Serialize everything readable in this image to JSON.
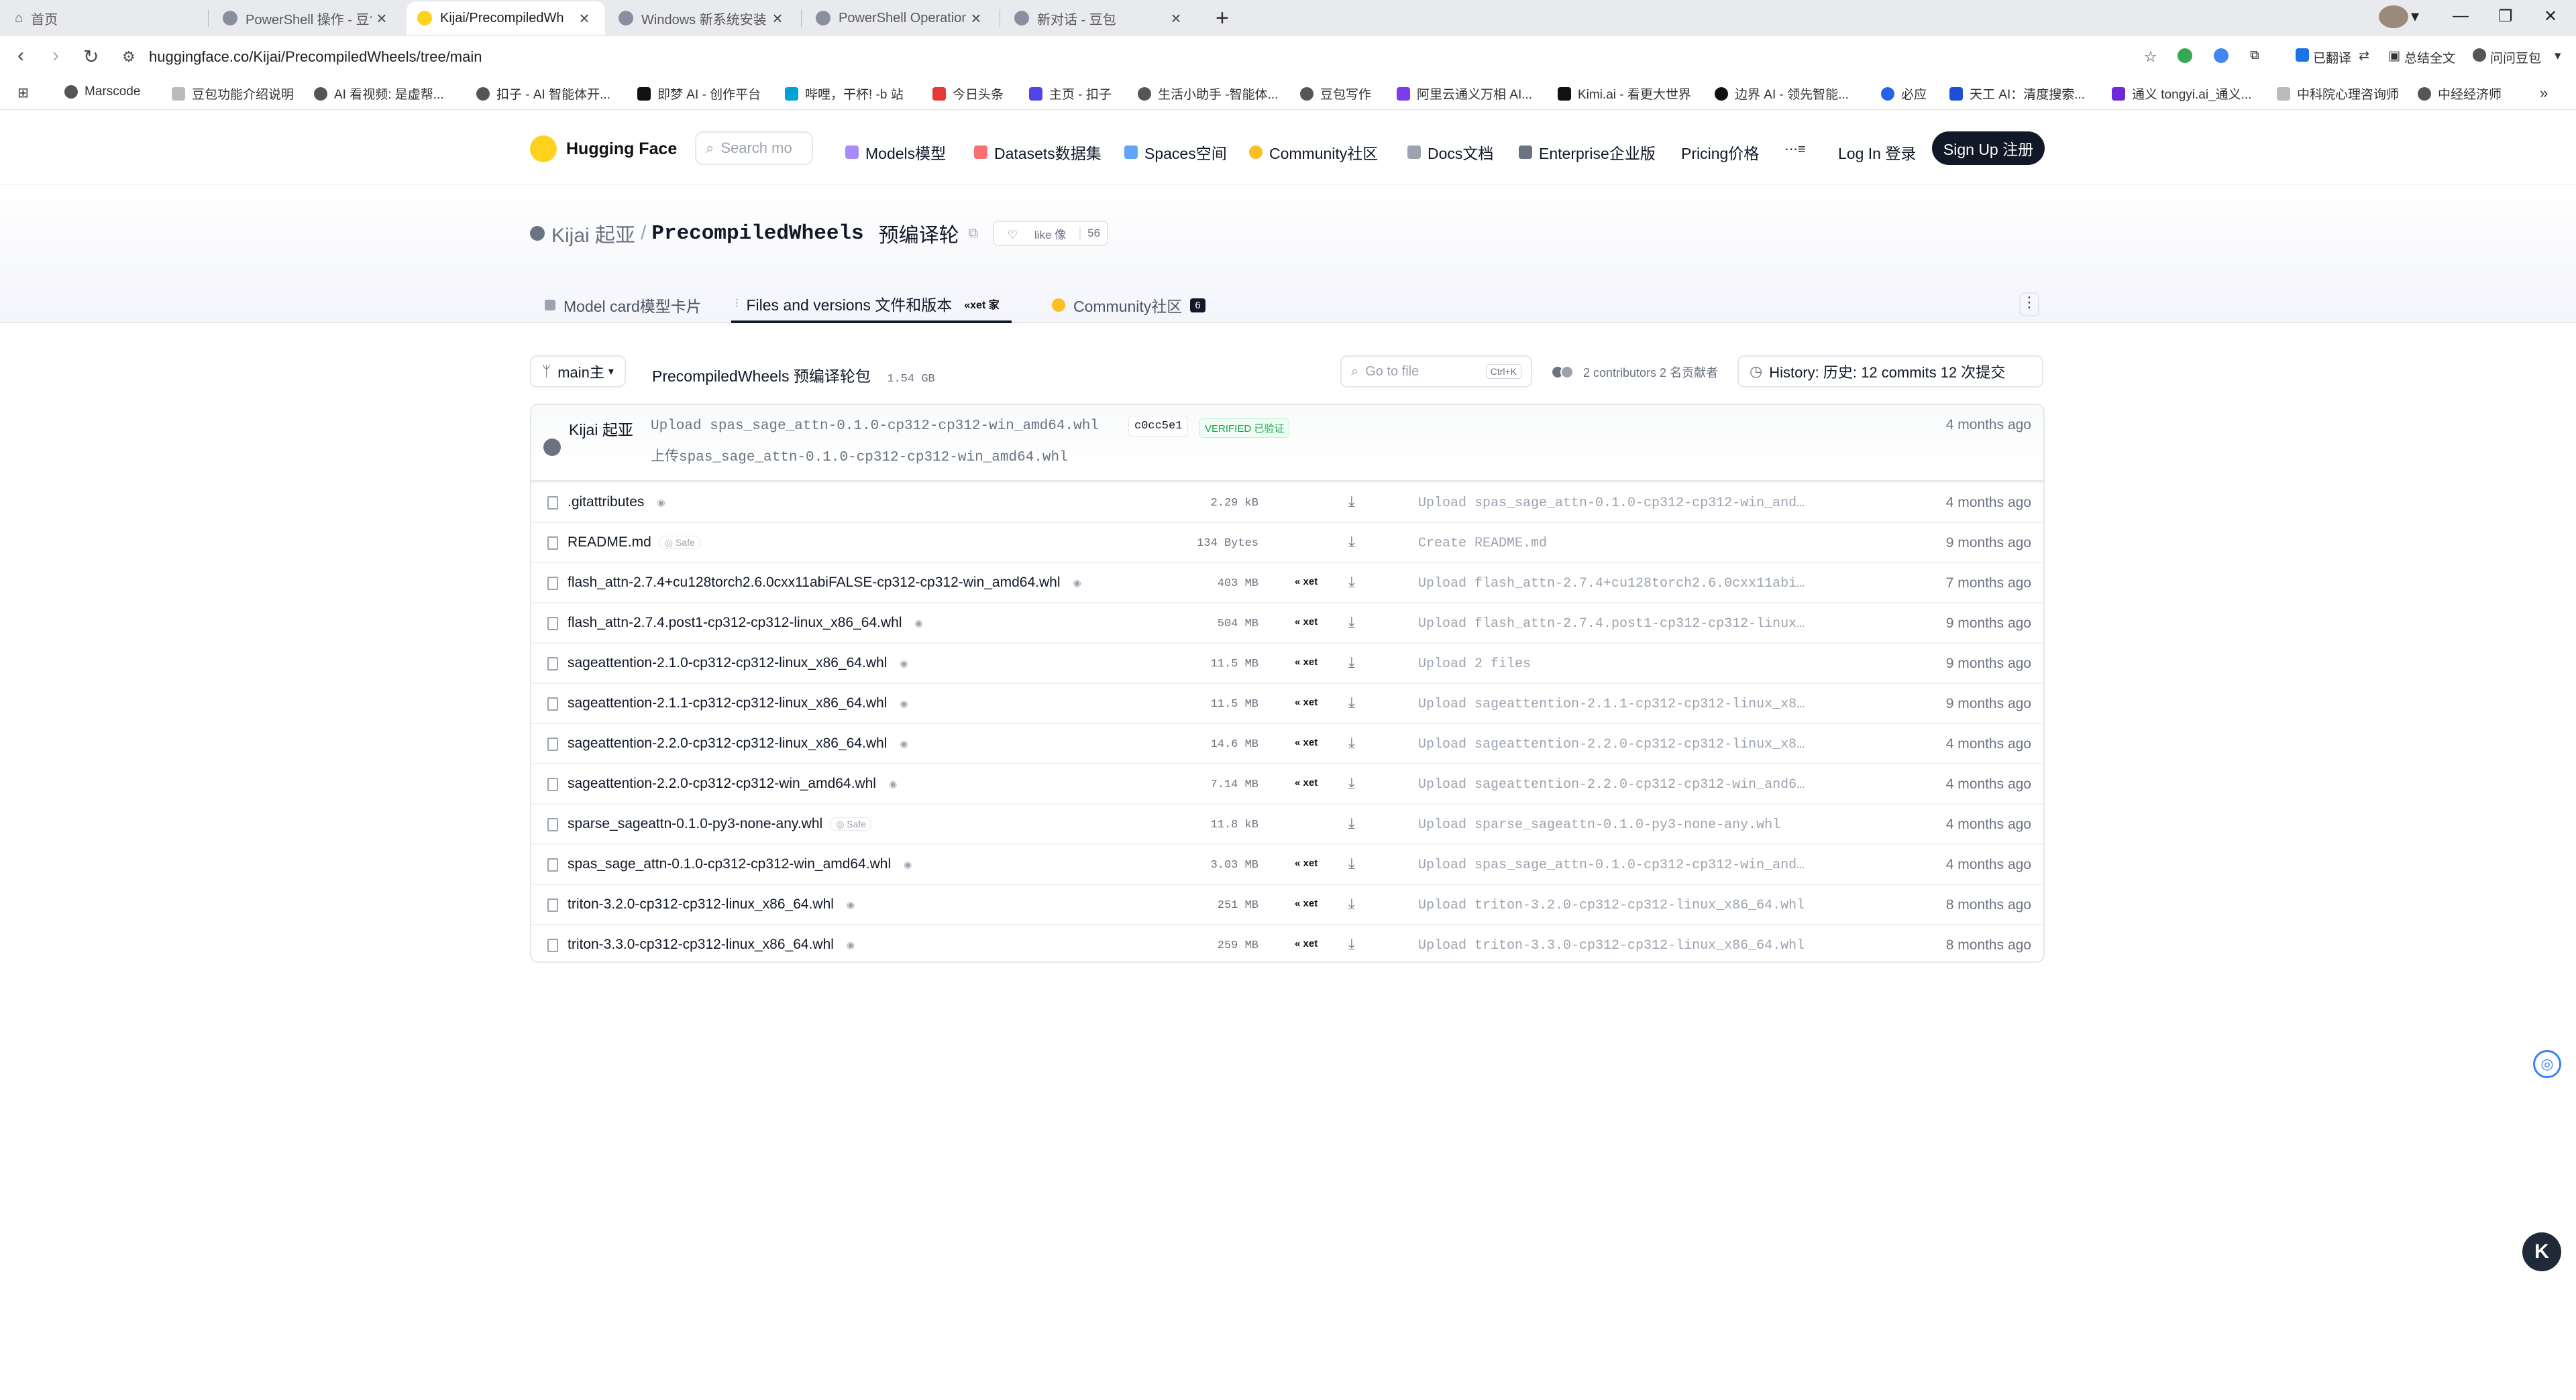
{
  "browser": {
    "tabs": [
      {
        "title": "首页",
        "icon": "home-icon"
      },
      {
        "title": "PowerShell 操作 - 豆包",
        "icon": "doubao-icon"
      },
      {
        "title": "Kijai/PrecompiledWh",
        "icon": "huggingface-icon"
      },
      {
        "title": "Windows 新系统安装 -",
        "icon": "doubao-icon"
      },
      {
        "title": "PowerShell Operation",
        "icon": "doubao-icon"
      },
      {
        "title": "新对话 - 豆包",
        "icon": "doubao-icon"
      }
    ],
    "url_host": "huggingface.co",
    "url_path": "/Kijai/PrecompiledWheels/tree/main",
    "toolbar": {
      "translated": "已翻译",
      "summary": "总结全文",
      "ask": "问问豆包"
    },
    "bookmarks": [
      "Marscode",
      "豆包功能介绍说明",
      "AI 看视频: 是虚帮...",
      "扣子 - AI 智能体开...",
      "即梦 AI - 创作平台",
      "哔哩，干杯! -b 站",
      "今日头条",
      "主页 - 扣子",
      "生活小助手 -智能体...",
      "豆包写作",
      "阿里云通义万相 AI...",
      "Kimi.ai - 看更大世界",
      "边界 AI - 领先智能...",
      "必应",
      "天工 AI：清度搜索...",
      "通义 tongyi.ai_通义...",
      "中科院心理咨询师",
      "中经经济师"
    ]
  },
  "hf": {
    "brand": "Hugging Face",
    "search_placeholder": "Search mo",
    "nav": [
      "Models模型",
      "Datasets数据集",
      "Spaces空间",
      "Community社区",
      "Docs文档",
      "Enterprise企业版",
      "Pricing价格"
    ],
    "login": "Log In 登录",
    "signup": "Sign Up 注册"
  },
  "repo": {
    "owner": "Kijai 起亚",
    "name": "PrecompiledWheels",
    "name_translated": "预编译轮",
    "like_label": "like 像",
    "like_count": "56",
    "tabs": {
      "model_card": "Model card模型卡片",
      "files": "Files and versions 文件和版本",
      "xet": "xet 家",
      "community": "Community社区",
      "community_count": "6"
    },
    "branch": "main主",
    "path": "PrecompiledWheels 预编译轮包",
    "size": "1.54 GB",
    "goto_placeholder": "Go to file",
    "goto_kbd": "Ctrl+K",
    "contributors": "2 contributors 2 名贡献者",
    "history": "History: 历史:  12 commits 12 次提交"
  },
  "last_commit": {
    "author": "Kijai 起亚",
    "message": "Upload spas_sage_attn-0.1.0-cp312-cp312-win_amd64.whl",
    "message_translated": "上传spas_sage_attn-0.1.0-cp312-cp312-win_amd64.whl",
    "hash": "c0cc5e1",
    "verified": "VERIFIED 已验证",
    "date": "4 months ago"
  },
  "files": [
    {
      "name": ".gitattributes",
      "badge": "",
      "size": "2.29 kB",
      "xet": "",
      "commit": "Upload spas_sage_attn-0.1.0-cp312-cp312-win_and…",
      "date": "4 months ago"
    },
    {
      "name": "README.md",
      "badge": "Safe",
      "size": "134 Bytes",
      "xet": "",
      "commit": "Create README.md",
      "date": "9 months ago"
    },
    {
      "name": "flash_attn-2.7.4+cu128torch2.6.0cxx11abiFALSE-cp312-cp312-win_amd64.whl",
      "badge": "",
      "size": "403 MB",
      "xet": "xet",
      "commit": "Upload flash_attn-2.7.4+cu128torch2.6.0cxx11abi…",
      "date": "7 months ago"
    },
    {
      "name": "flash_attn-2.7.4.post1-cp312-cp312-linux_x86_64.whl",
      "badge": "",
      "size": "504 MB",
      "xet": "xet",
      "commit": "Upload flash_attn-2.7.4.post1-cp312-cp312-linux…",
      "date": "9 months ago"
    },
    {
      "name": "sageattention-2.1.0-cp312-cp312-linux_x86_64.whl",
      "badge": "",
      "size": "11.5 MB",
      "xet": "xet",
      "commit": "Upload 2 files",
      "date": "9 months ago"
    },
    {
      "name": "sageattention-2.1.1-cp312-cp312-linux_x86_64.whl",
      "badge": "",
      "size": "11.5 MB",
      "xet": "xet",
      "commit": "Upload sageattention-2.1.1-cp312-cp312-linux_x8…",
      "date": "9 months ago"
    },
    {
      "name": "sageattention-2.2.0-cp312-cp312-linux_x86_64.whl",
      "badge": "",
      "size": "14.6 MB",
      "xet": "xet",
      "commit": "Upload sageattention-2.2.0-cp312-cp312-linux_x8…",
      "date": "4 months ago"
    },
    {
      "name": "sageattention-2.2.0-cp312-cp312-win_amd64.whl",
      "badge": "",
      "size": "7.14 MB",
      "xet": "xet",
      "commit": "Upload sageattention-2.2.0-cp312-cp312-win_and6…",
      "date": "4 months ago"
    },
    {
      "name": "sparse_sageattn-0.1.0-py3-none-any.whl",
      "badge": "Safe",
      "size": "11.8 kB",
      "xet": "",
      "commit": "Upload sparse_sageattn-0.1.0-py3-none-any.whl",
      "date": "4 months ago"
    },
    {
      "name": "spas_sage_attn-0.1.0-cp312-cp312-win_amd64.whl",
      "badge": "",
      "size": "3.03 MB",
      "xet": "xet",
      "commit": "Upload spas_sage_attn-0.1.0-cp312-cp312-win_and…",
      "date": "4 months ago"
    },
    {
      "name": "triton-3.2.0-cp312-cp312-linux_x86_64.whl",
      "badge": "",
      "size": "251 MB",
      "xet": "xet",
      "commit": "Upload triton-3.2.0-cp312-cp312-linux_x86_64.whl",
      "date": "8 months ago"
    },
    {
      "name": "triton-3.3.0-cp312-cp312-linux_x86_64.whl",
      "badge": "",
      "size": "259 MB",
      "xet": "xet",
      "commit": "Upload triton-3.3.0-cp312-cp312-linux_x86_64.whl",
      "date": "8 months ago"
    }
  ],
  "floating": {
    "k_label": "K"
  }
}
